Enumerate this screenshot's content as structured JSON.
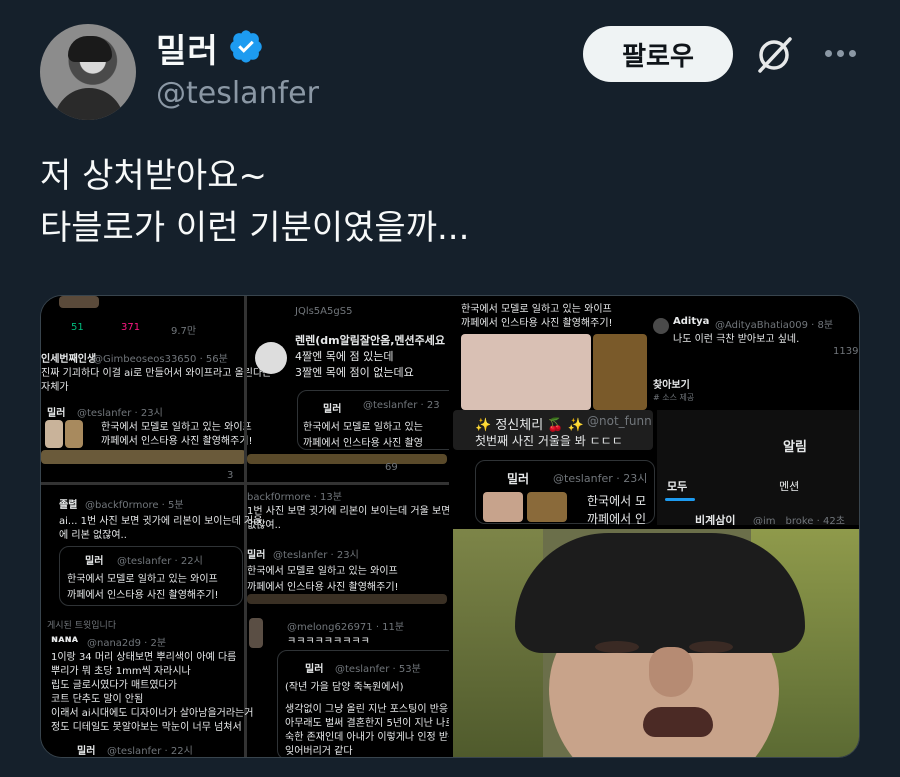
{
  "user": {
    "display_name": "밀러",
    "handle": "@teslanfer",
    "follow_label": "팔로우"
  },
  "tweet": {
    "lines": [
      "저 상처받아요~",
      "타블로가 이런 기분이였을까..."
    ]
  },
  "colors": {
    "background": "#15202b",
    "verified_blue": "#1d9bf0",
    "follow_bg": "#eff3f4",
    "secondary_text": "#8b98a5"
  },
  "icons": [
    "verified-badge-icon",
    "grok-icon",
    "more-icon"
  ],
  "media": {
    "left_panel": {
      "r1": {
        "reply": "51",
        "likes": "371",
        "views": "9.7만"
      },
      "r2": {
        "name": "인세번째인생",
        "handle": "@Gimbeoseos33650 · 56분",
        "text1": "진짜 기괴하다 이걸 ai로 만들어서 와이프라고 올린다는",
        "text2": "자체가"
      },
      "r3": {
        "name": "밀러",
        "handle": "@teslanfer · 23시",
        "text1": "한국에서 모델로 일하고 있는 와이프",
        "text2": "까페에서 인스타용 사진 촬영해주기!"
      },
      "r4": {
        "views": "3"
      },
      "r5": {
        "top": "JQls5A5gS5",
        "name": "렌렌(dm알림잘안옴,멘션주세요",
        "text1": "4짤엔 목에 점 있는데",
        "text2": "3짤엔 목에 점이 없는데요"
      },
      "r6": {
        "name": "밀러",
        "handle": "@teslanfer · 23",
        "text1": "한국에서 모델로 일하고 있는",
        "text2": "까페에서 인스타용 사진 촬영"
      },
      "r7": {
        "views": "69"
      },
      "r8": {
        "name": "졸렬",
        "handle": "@backf0rmore · 5분",
        "text1": "ai... 1번 사진 보면 귓가에 리본이 보이는데 거울",
        "text2": "에 리본 없잖여..",
        "q_name": "밀러",
        "q_handle": "@teslanfer · 22시",
        "q1": "한국에서 모델로 일하고 있는 와이프",
        "q2": "까페에서 인스타용 사진 촬영해주기!"
      },
      "r9": {
        "handle": "backf0rmore · 13분",
        "text1": "1번 사진 보면 귓가에 리본이 보이는데 거울 보면 뒤통",
        "text2": "없잖여..",
        "q_name": "밀러",
        "q_handle": "@teslanfer · 23시",
        "q1": "한국에서 모델로 일하고 있는 와이프",
        "q2": "까페에서 인스타용 사진 촬영해주기!"
      },
      "r10": {
        "deleted": "게시된 트윗입니다",
        "name": "ɴᴀɴᴀ",
        "handle": "@nana2d9 · 2분",
        "l1": "1이랑 34 머리 상태보면 뿌리색이 아예 다름",
        "l2": "뿌리가 뭐 초당 1mm씩 자라시나",
        "l3": "립도 글로시였다가 매트였다가",
        "l4": "코트 단추도 말이 안됨",
        "l5": "이래서 ai시대에도 디자이너가 살아남을거라는거",
        "l6": "정도 디테일도 못알아보는 막눈이 너무 넘쳐서",
        "b_name": "밀러",
        "b_handle": "@teslanfer · 22시"
      },
      "r11": {
        "handle": "@melong626971 · 11분",
        "ks": "ㅋㅋㅋㅋㅋㅋㅋㅋㅋ",
        "q_name": "밀러",
        "q_handle": "@teslanfer · 53분",
        "q1": "(작년 가을 담양 죽녹원에서)",
        "q2": "생각없이 그냥 올린 지난 포스팅이 반응이",
        "q3": "아무래도 벌써 결혼한지 5년이 지난 나로서",
        "q4": "숙한 존재인데 아내가 이렇게나 인정 받는",
        "q5": "잊어버리거 같다"
      }
    },
    "right_top": {
      "a1": "한국에서 모델로 일하고 있는 와이프",
      "a2": "까페에서 인스타용 사진 촬영해주기!",
      "b_name": "Aditya",
      "b_handle": "@AdityaBhatia009 · 8분",
      "b_text": "나도 이런 극찬 받아보고 싶네.",
      "b_views": "1139",
      "c1": "찾아보기",
      "c2": "# 소스 제공",
      "d_name": "✨ 정신체리 🍒 ✨",
      "d_handle": "@not_funn",
      "d_text": "첫번째 사진 거울을 봐 ㄷㄷㄷ",
      "e_name": "밀러",
      "e_handle": "@teslanfer · 23시",
      "e1": "한국에서 모",
      "e2": "까페에서 인",
      "notif_title": "알림",
      "tab_all": "모두",
      "tab_mention": "멘션",
      "f_text": "비계삼이",
      "f_handle": "@im__broke · 42초"
    }
  }
}
